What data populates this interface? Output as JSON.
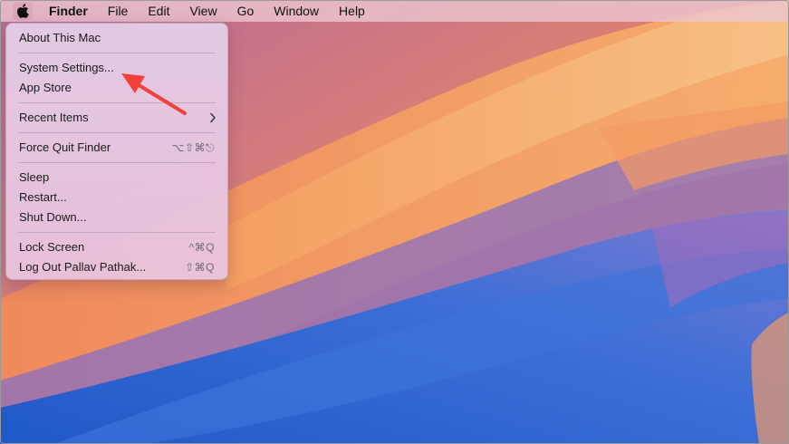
{
  "menubar": {
    "app_name": "Finder",
    "items": [
      "File",
      "Edit",
      "View",
      "Go",
      "Window",
      "Help"
    ]
  },
  "apple_menu": {
    "groups": [
      [
        {
          "label": "About This Mac",
          "shortcut": ""
        }
      ],
      [
        {
          "label": "System Settings...",
          "shortcut": ""
        },
        {
          "label": "App Store",
          "shortcut": ""
        }
      ],
      [
        {
          "label": "Recent Items",
          "shortcut": ""
        }
      ],
      [
        {
          "label": "Force Quit Finder",
          "shortcut": "⌥⇧⌘⎋"
        }
      ],
      [
        {
          "label": "Sleep",
          "shortcut": ""
        },
        {
          "label": "Restart...",
          "shortcut": ""
        },
        {
          "label": "Shut Down...",
          "shortcut": ""
        }
      ],
      [
        {
          "label": "Lock Screen",
          "shortcut": "^⌘Q"
        },
        {
          "label": "Log Out Pallav Pathak...",
          "shortcut": "⇧⌘Q"
        }
      ]
    ]
  },
  "colors": {
    "annotation_arrow": "#f0413a",
    "menubar_bg": "#ecc4ce",
    "menu_bg": "#e4cee8"
  },
  "icons": {
    "apple_logo": "apple-icon",
    "submenu": "chevron-right-icon"
  }
}
